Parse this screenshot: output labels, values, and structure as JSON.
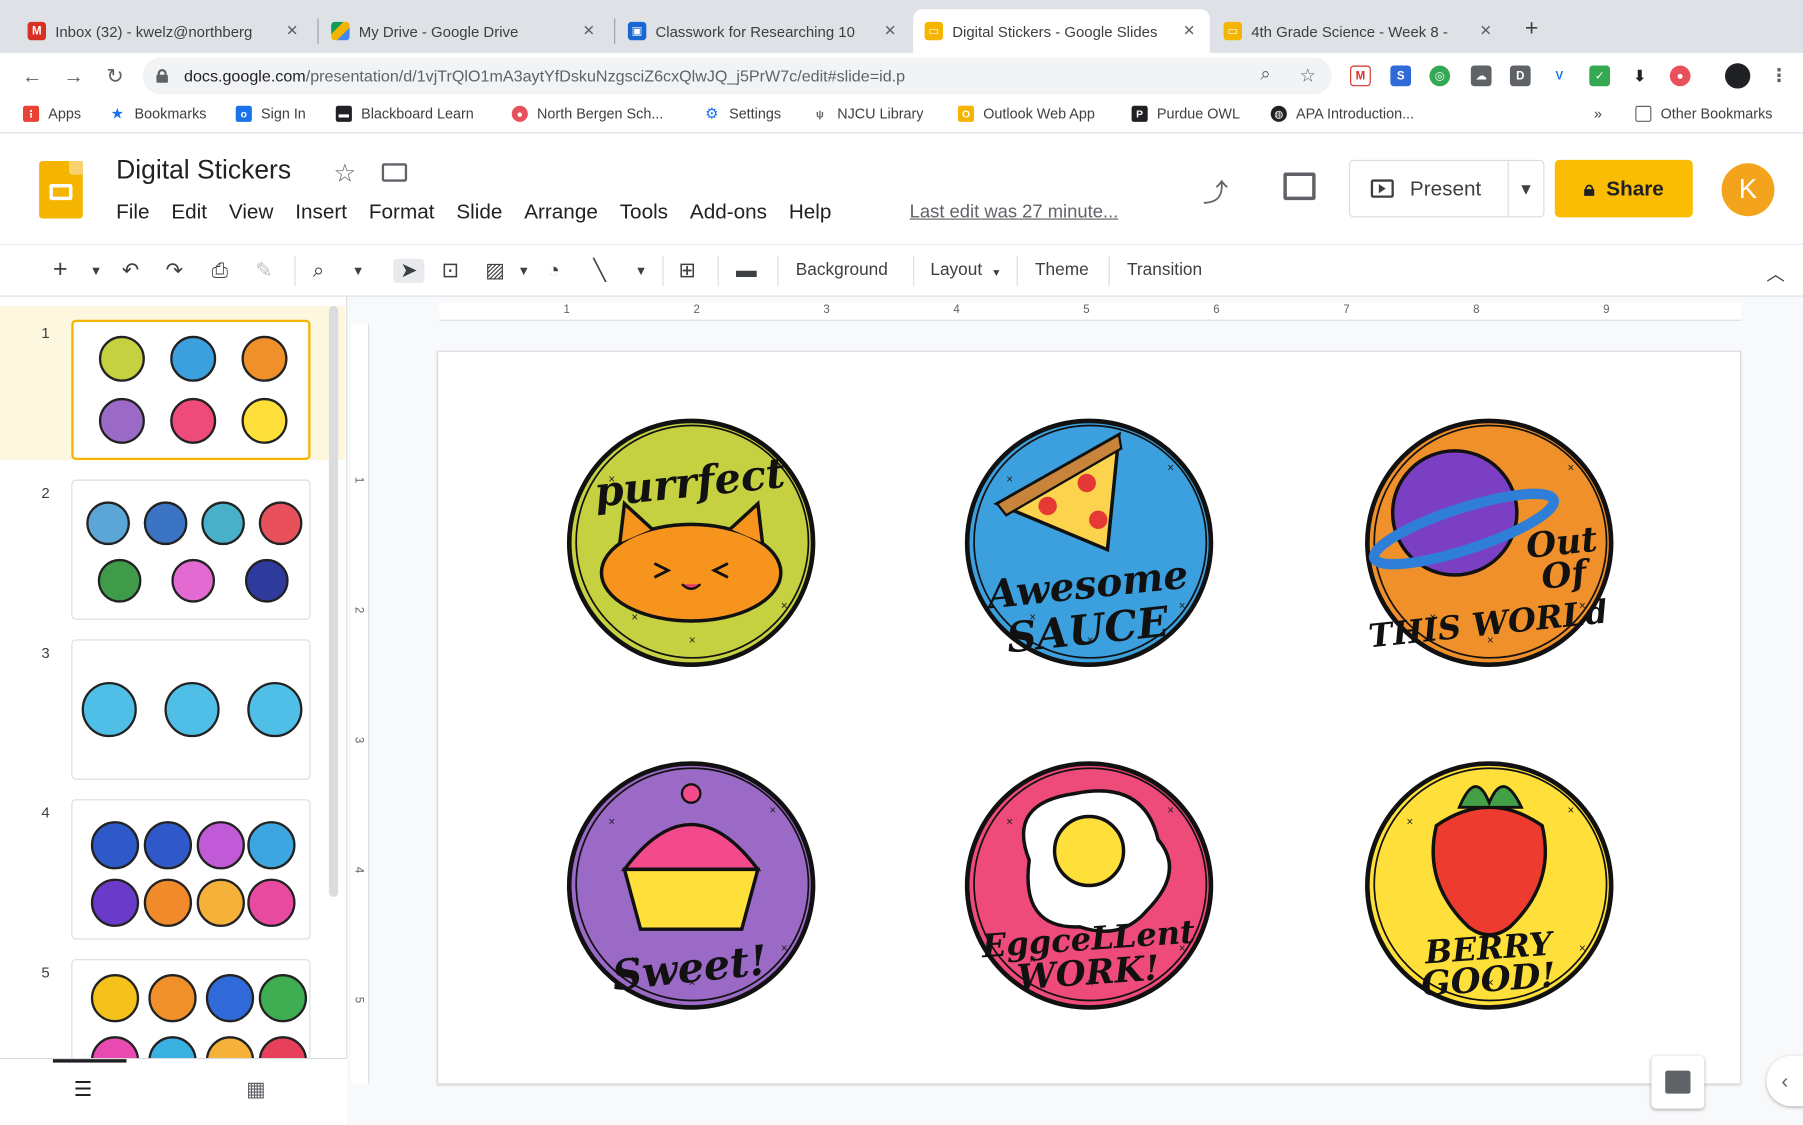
{
  "browser": {
    "tabs": [
      {
        "title": "Inbox (32) - kwelz@northberg",
        "color": "#d93025",
        "icon": "gmail-icon"
      },
      {
        "title": "My Drive - Google Drive",
        "color": "#1a73e8",
        "icon": "drive-icon"
      },
      {
        "title": "Classwork for Researching 10",
        "color": "#1967d2",
        "icon": "classroom-icon"
      },
      {
        "title": "Digital Stickers - Google Slides",
        "color": "#f4b400",
        "icon": "slides-icon",
        "active": true
      },
      {
        "title": "4th Grade Science - Week 8 -",
        "color": "#f4b400",
        "icon": "slides-icon"
      }
    ],
    "new_tab": "+",
    "url_host": "docs.google.com",
    "url_path": "/presentation/d/1vjTrQlO1mA3aytYfDskuNzgsciZ6cxQlwJQ_j5PrW7c/edit#slide=id.p",
    "bookmarks": [
      "Apps",
      "Bookmarks",
      "Sign In",
      "Blackboard Learn",
      "North Bergen Sch...",
      "Settings",
      "NJCU Library",
      "Outlook Web App",
      "Purdue OWL",
      "APA Introduction..."
    ],
    "bookmarks_overflow": "»",
    "other_bookmarks": "Other Bookmarks"
  },
  "app": {
    "doc_title": "Digital Stickers",
    "menu": [
      "File",
      "Edit",
      "View",
      "Insert",
      "Format",
      "Slide",
      "Arrange",
      "Tools",
      "Add-ons",
      "Help"
    ],
    "last_edit": "Last edit was 27 minute...",
    "present_label": "Present",
    "share_label": "Share",
    "avatar_letter": "K"
  },
  "toolbar": {
    "background": "Background",
    "layout": "Layout",
    "theme": "Theme",
    "transition": "Transition"
  },
  "ruler": {
    "top": [
      "1",
      "2",
      "3",
      "4",
      "5",
      "6",
      "7",
      "8",
      "9"
    ],
    "left": [
      "1",
      "2",
      "3",
      "4",
      "5"
    ]
  },
  "filmstrip": {
    "slides": [
      {
        "number": "1",
        "colors": [
          "#c5d140",
          "#3ba0dd",
          "#f0902a",
          "#9b6ac6",
          "#ee4a7a",
          "#ffe03a"
        ]
      },
      {
        "number": "2",
        "colors": [
          "#5ba6d6",
          "#3b74c4",
          "#48b0c8",
          "#e8505b",
          "#3f9b4a",
          "#e36ad0",
          "#2e3b9c"
        ]
      },
      {
        "number": "3",
        "colors": [
          "#4fbfe8",
          "#4fbfe8",
          "#4fbfe8"
        ]
      },
      {
        "number": "4",
        "colors": [
          "#2f58c8",
          "#2f58c8",
          "#c05ad6",
          "#3da6e0",
          "#6a3bc8",
          "#f08a2a",
          "#f5b13a",
          "#e84aa0"
        ]
      },
      {
        "number": "5",
        "colors": [
          "#f4c21a",
          "#f0902a",
          "#2f6ad8",
          "#3fae52",
          "#e84ab0",
          "#38b0e0",
          "#f5b13a",
          "#e8405a"
        ]
      }
    ]
  },
  "stickers": [
    {
      "name": "purrfect",
      "bg": "#c5d140",
      "line1": "purrfect",
      "line2": "",
      "line3": ""
    },
    {
      "name": "awesome-sauce",
      "bg": "#3ba0dd",
      "line1": "Awesome",
      "line2": "SAUCE",
      "line3": ""
    },
    {
      "name": "out-of-this-world",
      "bg": "#f0902a",
      "line1": "Out",
      "line2": "Of",
      "line3": "THIS WORLd"
    },
    {
      "name": "sweet",
      "bg": "#9b6ac6",
      "line1": "Sweet!",
      "line2": "",
      "line3": ""
    },
    {
      "name": "eggcellent-work",
      "bg": "#ee4a7a",
      "line1": "EggceLLent",
      "line2": "WORK!",
      "line3": ""
    },
    {
      "name": "berry-good",
      "bg": "#ffe03a",
      "line1": "BERRY",
      "line2": "GOOD!",
      "line3": ""
    }
  ]
}
